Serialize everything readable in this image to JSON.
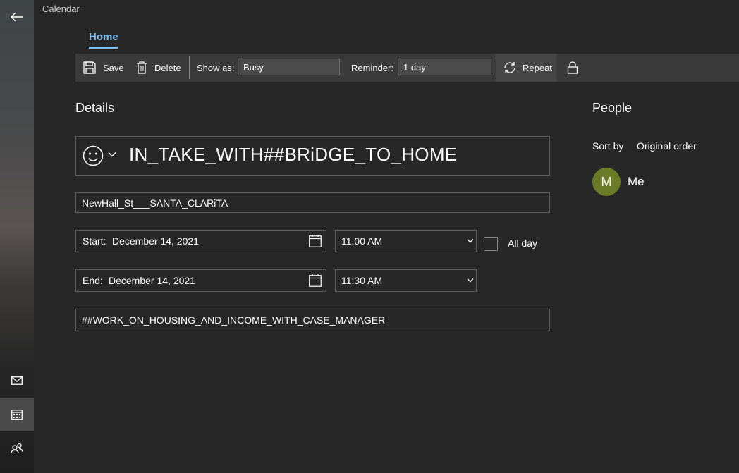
{
  "app": {
    "title": "Calendar"
  },
  "tabs": [
    {
      "label": "Home",
      "active": true
    }
  ],
  "toolbar": {
    "save_label": "Save",
    "delete_label": "Delete",
    "show_as_label": "Show as:",
    "show_as_value": "Busy",
    "reminder_label": "Reminder:",
    "reminder_value": "1 day",
    "repeat_label": "Repeat"
  },
  "details": {
    "heading": "Details",
    "title": "IN_TAKE_WITH##BRiDGE_TO_HOME",
    "location": "NewHall_St___SANTA_CLARiTA",
    "start": {
      "label": "Start:",
      "date": "December 14, 2021",
      "time": "11:00 AM"
    },
    "end": {
      "label": "End:",
      "date": "December 14, 2021",
      "time": "11:30 AM"
    },
    "all_day_label": "All day",
    "all_day_checked": false,
    "notes": "##WORK_ON_HOUSING_AND_INCOME_WITH_CASE_MANAGER"
  },
  "people": {
    "heading": "People",
    "sort_label": "Sort by",
    "sort_value": "Original order",
    "attendees": [
      {
        "initial": "M",
        "name": "Me",
        "avatar_color": "#6b7a26"
      }
    ]
  },
  "colors": {
    "accent": "#7fbff0",
    "background": "#272727",
    "toolbar": "#3a3a3a"
  },
  "icons": {
    "rail": [
      "back-arrow-icon",
      "mail-icon",
      "calendar-icon",
      "people-icon"
    ],
    "toolbar": [
      "save-icon",
      "delete-icon",
      "repeat-icon",
      "lock-icon"
    ]
  }
}
